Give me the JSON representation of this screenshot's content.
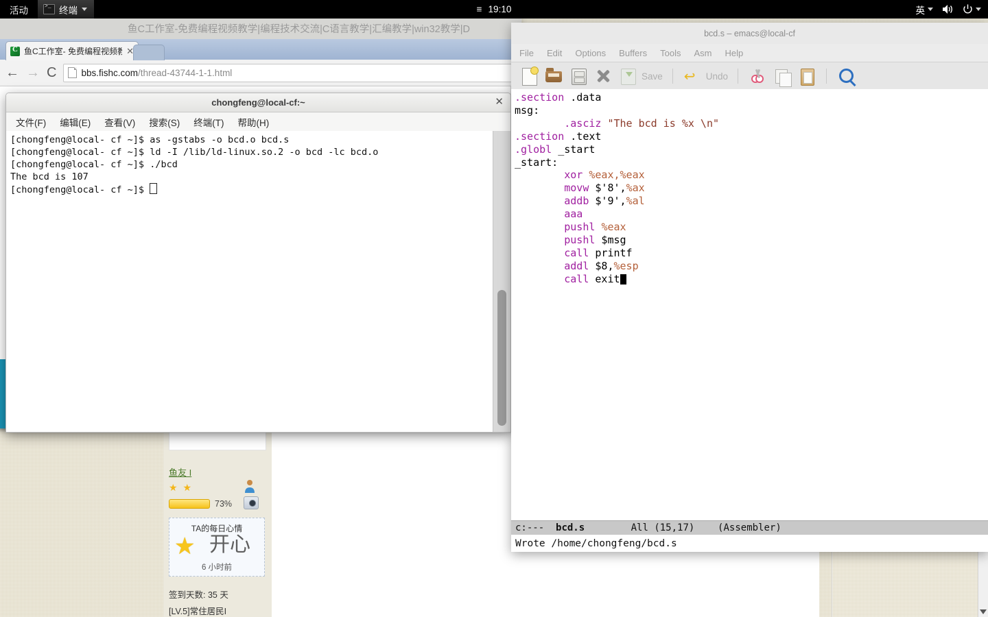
{
  "topbar": {
    "activities": "活动",
    "app_icon": "terminal-icon",
    "app_name": "终端",
    "calendar_icon": "≡",
    "clock": "19:10",
    "input_method": "英",
    "volume_icon": "volume-icon",
    "power_icon": "power-icon"
  },
  "browser": {
    "window_title": "鱼C工作室-免费编程视频教学|编程技术交流|C语言教学|汇编教学|win32教学|D",
    "tab": {
      "favicon": "fishc-logo-icon",
      "title": "鱼C工作室- 免费编程视频教",
      "close": "✕"
    },
    "nav": {
      "back": "←",
      "forward": "→",
      "reload": "C"
    },
    "omnibox": {
      "page_icon": "page-icon",
      "url_host": "bbs.fishc.com",
      "url_path": "/thread-43744-1-1.html"
    }
  },
  "webpage": {
    "user": {
      "name": "鱼友 I",
      "stars": "★ ★",
      "progress_pct": "73%",
      "mood_title": "TA的每日心情",
      "mood_word": "开心",
      "mood_star_icon": "happy-star-icon",
      "mood_time": "6 小时前",
      "sign_days": "签到天数: 35 天",
      "level": "[LV.5]常住居民I"
    },
    "scroll_down_icon": "chevron-down-icon"
  },
  "terminal": {
    "title": "chongfeng@local-cf:~",
    "close": "✕",
    "menu": [
      "文件(F)",
      "编辑(E)",
      "查看(V)",
      "搜索(S)",
      "终端(T)",
      "帮助(H)"
    ],
    "lines": [
      "[chongfeng@local- cf ~]$ as -gstabs -o bcd.o bcd.s",
      "[chongfeng@local- cf ~]$ ld -I /lib/ld-linux.so.2 -o bcd -lc bcd.o",
      "[chongfeng@local- cf ~]$ ./bcd",
      "The bcd is 107",
      "[chongfeng@local- cf ~]$ "
    ]
  },
  "emacs": {
    "title": "bcd.s – emacs@local-cf",
    "menu": [
      "File",
      "Edit",
      "Options",
      "Buffers",
      "Tools",
      "Asm",
      "Help"
    ],
    "toolbar": [
      {
        "name": "new-file-icon",
        "label": ""
      },
      {
        "name": "open-file-icon",
        "label": ""
      },
      {
        "name": "save-as-icon",
        "label": ""
      },
      {
        "name": "close-buffer-icon",
        "label": ""
      },
      {
        "name": "save-icon",
        "label": "Save"
      },
      {
        "name": "undo-icon",
        "label": "Undo"
      },
      {
        "name": "cut-icon",
        "label": ""
      },
      {
        "name": "copy-icon",
        "label": ""
      },
      {
        "name": "paste-icon",
        "label": ""
      },
      {
        "name": "search-icon",
        "label": ""
      }
    ],
    "code_lines": [
      [
        {
          "t": ".section",
          "c": "kw"
        },
        {
          "t": " .data",
          "c": "lbl"
        }
      ],
      [
        {
          "t": "msg:",
          "c": "lbl"
        }
      ],
      [
        {
          "t": "        ",
          "c": "lbl"
        },
        {
          "t": ".asciz",
          "c": "kw"
        },
        {
          "t": " ",
          "c": "lbl"
        },
        {
          "t": "\"The bcd is %x \\n\"",
          "c": "str"
        }
      ],
      [
        {
          "t": ".section",
          "c": "kw"
        },
        {
          "t": " .text",
          "c": "lbl"
        }
      ],
      [
        {
          "t": ".globl",
          "c": "kw"
        },
        {
          "t": " _start",
          "c": "lbl"
        }
      ],
      [
        {
          "t": "_start:",
          "c": "lbl"
        }
      ],
      [
        {
          "t": "        ",
          "c": "lbl"
        },
        {
          "t": "xor",
          "c": "kw"
        },
        {
          "t": " ",
          "c": "lbl"
        },
        {
          "t": "%eax,%eax",
          "c": "reg"
        }
      ],
      [
        {
          "t": "        ",
          "c": "lbl"
        },
        {
          "t": "movw",
          "c": "kw"
        },
        {
          "t": " $'8',",
          "c": "lbl"
        },
        {
          "t": "%ax",
          "c": "reg"
        }
      ],
      [
        {
          "t": "        ",
          "c": "lbl"
        },
        {
          "t": "addb",
          "c": "kw"
        },
        {
          "t": " $'9',",
          "c": "lbl"
        },
        {
          "t": "%al",
          "c": "reg"
        }
      ],
      [
        {
          "t": "        ",
          "c": "lbl"
        },
        {
          "t": "aaa",
          "c": "kw"
        }
      ],
      [
        {
          "t": "        ",
          "c": "lbl"
        },
        {
          "t": "pushl",
          "c": "kw"
        },
        {
          "t": " ",
          "c": "lbl"
        },
        {
          "t": "%eax",
          "c": "reg"
        }
      ],
      [
        {
          "t": "        ",
          "c": "lbl"
        },
        {
          "t": "pushl",
          "c": "kw"
        },
        {
          "t": " $msg",
          "c": "lbl"
        }
      ],
      [
        {
          "t": "        ",
          "c": "lbl"
        },
        {
          "t": "call",
          "c": "kw"
        },
        {
          "t": " printf",
          "c": "lbl"
        }
      ],
      [
        {
          "t": "        ",
          "c": "lbl"
        },
        {
          "t": "addl",
          "c": "kw"
        },
        {
          "t": " $8,",
          "c": "lbl"
        },
        {
          "t": "%esp",
          "c": "reg"
        }
      ],
      [
        {
          "t": "        ",
          "c": "lbl"
        },
        {
          "t": "call",
          "c": "kw"
        },
        {
          "t": " exit",
          "c": "lbl"
        },
        {
          "t": "CURSOR",
          "c": "cur"
        }
      ]
    ],
    "modeline": {
      "flags": "c:---",
      "buffer": "bcd.s",
      "position": "All (15,17)",
      "mode": "(Assembler)"
    },
    "echo": "Wrote /home/chongfeng/bcd.s"
  }
}
